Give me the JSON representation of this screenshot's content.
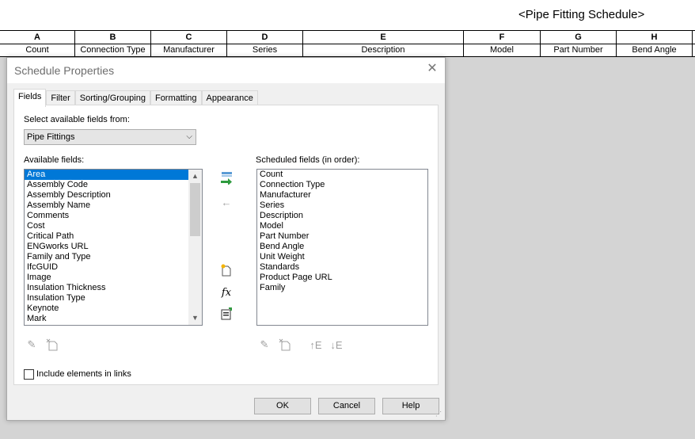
{
  "schedule": {
    "title": "<Pipe Fitting Schedule>",
    "columns": [
      {
        "letter": "A",
        "header": "Count"
      },
      {
        "letter": "B",
        "header": "Connection Type"
      },
      {
        "letter": "C",
        "header": "Manufacturer"
      },
      {
        "letter": "D",
        "header": "Series"
      },
      {
        "letter": "E",
        "header": "Description"
      },
      {
        "letter": "F",
        "header": "Model"
      },
      {
        "letter": "G",
        "header": "Part Number"
      },
      {
        "letter": "H",
        "header": "Bend Angle"
      }
    ]
  },
  "dialog": {
    "title": "Schedule Properties",
    "close_icon": "close-icon",
    "tabs": [
      "Fields",
      "Filter",
      "Sorting/Grouping",
      "Formatting",
      "Appearance"
    ],
    "active_tab": "Fields",
    "select_from_label": "Select available fields from:",
    "category": "Pipe Fittings",
    "available_label": "Available fields:",
    "scheduled_label": "Scheduled fields (in order):",
    "available_fields": [
      "Area",
      "Assembly Code",
      "Assembly Description",
      "Assembly Name",
      "Comments",
      "Cost",
      "Critical Path",
      "ENGworks URL",
      "Family and Type",
      "IfcGUID",
      "Image",
      "Insulation Thickness",
      "Insulation Type",
      "Keynote",
      "Mark"
    ],
    "selected_available": "Area",
    "scheduled_fields": [
      "Count",
      "Connection Type",
      "Manufacturer",
      "Series",
      "Description",
      "Model",
      "Part Number",
      "Bend Angle",
      "Unit Weight",
      "Standards",
      "Product Page URL",
      "Family"
    ],
    "include_links_label": "Include elements in links",
    "include_links_checked": false,
    "ok_label": "OK",
    "cancel_label": "Cancel",
    "help_label": "Help",
    "formula_label": "fx",
    "move_up_label": "↑E",
    "move_down_label": "↓E"
  },
  "colors": {
    "selection": "#0078d7",
    "add_arrow": "#2e9a3e",
    "dialog_bg": "#f0f0f0"
  }
}
